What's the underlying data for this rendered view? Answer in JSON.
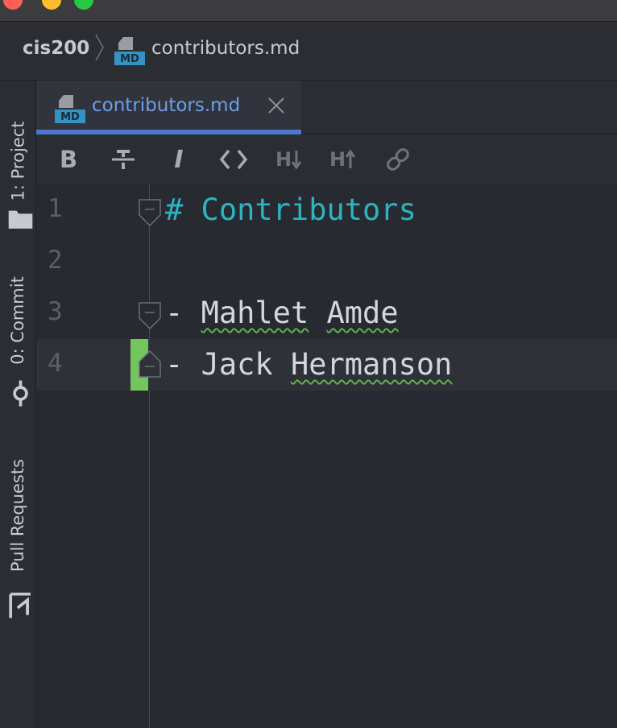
{
  "breadcrumb": {
    "project": "cis200",
    "file": "contributors.md",
    "file_icon_label": "MD"
  },
  "side_tools": [
    {
      "label": "1: Project",
      "icon": "folder-icon"
    },
    {
      "label": "0: Commit",
      "icon": "commit-icon"
    },
    {
      "label": "Pull Requests",
      "icon": "pull-request-icon"
    }
  ],
  "tab": {
    "label": "contributors.md",
    "icon_label": "MD"
  },
  "md_toolbar": {
    "bold": "B",
    "italic": "I",
    "h_down": "H",
    "h_up": "H"
  },
  "editor": {
    "lines": [
      {
        "number": "1",
        "text": "# Contributors"
      },
      {
        "number": "2",
        "text": ""
      },
      {
        "number": "3",
        "prefix": "- ",
        "word1": "Mahlet",
        "word2": "Amde"
      },
      {
        "number": "4",
        "prefix": "- ",
        "word1": "Jack",
        "word2": "Hermanson"
      }
    ],
    "current_line": "4"
  },
  "colors": {
    "accent": "#4d78cc",
    "heading": "#2ab5c0",
    "change_marker": "#74c55d",
    "spellcheck": "#5fb04f"
  }
}
